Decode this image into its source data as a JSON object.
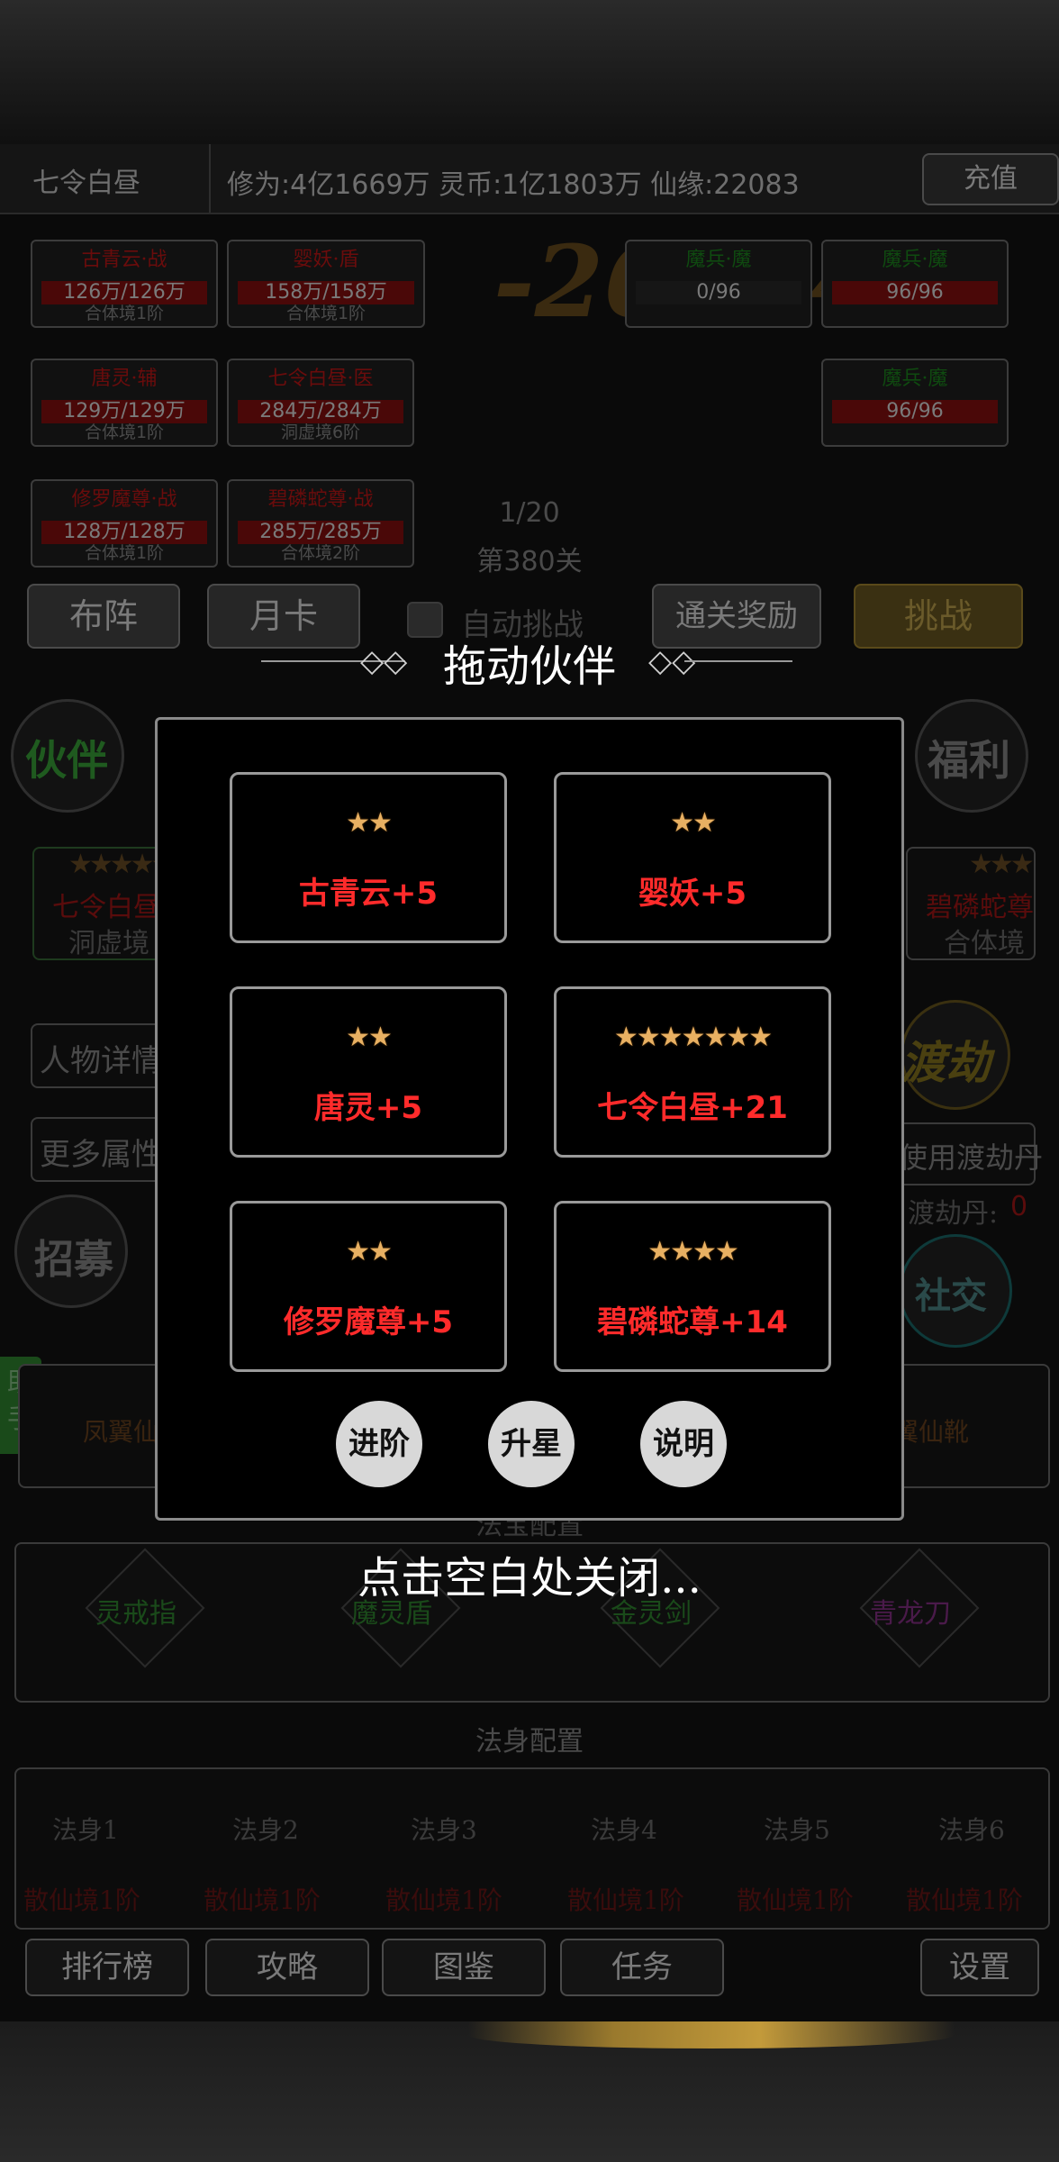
{
  "header": {
    "name": "七令白昼",
    "stats": "修为:4亿1669万 灵币:1亿1803万 仙缘:22083",
    "recharge": "充值"
  },
  "battle": {
    "damage": "-264540",
    "progress": "1/20",
    "stage": "第380关",
    "allies": [
      {
        "name": "古青云·战",
        "hp": "126万/126万",
        "level": "合体境1阶"
      },
      {
        "name": "婴妖·盾",
        "hp": "158万/158万",
        "level": "合体境1阶"
      },
      {
        "name": "唐灵·辅",
        "hp": "129万/129万",
        "level": "合体境1阶"
      },
      {
        "name": "七令白昼·医",
        "hp": "284万/284万",
        "level": "洞虚境6阶"
      },
      {
        "name": "修罗魔尊·战",
        "hp": "128万/128万",
        "level": "合体境1阶"
      },
      {
        "name": "碧磷蛇尊·战",
        "hp": "285万/285万",
        "level": "合体境2阶"
      }
    ],
    "enemies": [
      {
        "name": "魔兵·魔",
        "hp": "0/96"
      },
      {
        "name": "魔兵·魔",
        "hp": "96/96"
      },
      {
        "name": "魔兵·魔",
        "hp": "96/96"
      }
    ]
  },
  "actions": {
    "formation": "布阵",
    "monthly": "月卡",
    "auto": "自动挑战",
    "reward": "通关奖励",
    "challenge": "挑战"
  },
  "tabs": {
    "partner": "伙伴",
    "welfare": "福利",
    "recruit": "招募",
    "social": "社交",
    "tribulation": "渡劫"
  },
  "bg_panel": {
    "left_stars": "★★★★★",
    "left_name": "七令白昼",
    "left_realm": "洞虚境",
    "right_stars": "★★★",
    "right_name": "碧磷蛇尊",
    "right_realm": "合体境",
    "detail_btn": "人物详情",
    "more_btn": "更多属性",
    "use_pill": "使用渡劫丹",
    "pill_label": "渡劫丹:",
    "pill_count": "0",
    "helper": "助手",
    "gear_left": "凤翼仙靴",
    "gear_right": "凤翼仙靴"
  },
  "magic": {
    "title": "法宝配置",
    "items": [
      "灵戒指",
      "魔灵盾",
      "金灵剑",
      "青龙刀"
    ]
  },
  "body_cfg": {
    "title": "法身配置",
    "slots": [
      {
        "name": "法身1",
        "realm": "散仙境1阶"
      },
      {
        "name": "法身2",
        "realm": "散仙境1阶"
      },
      {
        "name": "法身3",
        "realm": "散仙境1阶"
      },
      {
        "name": "法身4",
        "realm": "散仙境1阶"
      },
      {
        "name": "法身5",
        "realm": "散仙境1阶"
      },
      {
        "name": "法身6",
        "realm": "散仙境1阶"
      }
    ]
  },
  "bottom_nav": {
    "rank": "排行榜",
    "guide": "攻略",
    "codex": "图鉴",
    "task": "任务",
    "settings": "设置"
  },
  "dialog": {
    "title": "拖动伙伴",
    "partners": [
      {
        "stars": "★★",
        "label": "古青云+5"
      },
      {
        "stars": "★★",
        "label": "婴妖+5"
      },
      {
        "stars": "★★",
        "label": "唐灵+5"
      },
      {
        "stars": "★★★★★★★",
        "label": "七令白昼+21"
      },
      {
        "stars": "★★",
        "label": "修罗魔尊+5"
      },
      {
        "stars": "★★★★",
        "label": "碧磷蛇尊+14"
      }
    ],
    "advance": "进阶",
    "star_up": "升星",
    "explain": "说明",
    "close_hint": "点击空白处关闭..."
  },
  "colors": {
    "dialog_border": "#8a8a8a",
    "label_red": "#ff2b2b",
    "star_gold": "#e8b062"
  }
}
